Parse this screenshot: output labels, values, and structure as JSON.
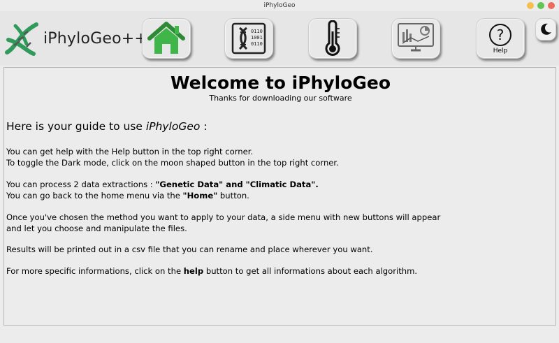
{
  "window": {
    "title": "iPhyloGeo"
  },
  "logo": {
    "text": "iPhyloGeo++"
  },
  "toolbar": {
    "home_icon": "house-icon",
    "genetic_icon": "dna-data-icon",
    "climate_icon": "thermometer-icon",
    "stats_icon": "chart-monitor-icon",
    "help_label": "Help",
    "help_icon": "question-circle-icon",
    "dark_mode_icon": "moon-icon"
  },
  "main": {
    "title": "Welcome to iPhyloGeo",
    "subtitle": "Thanks for downloading our software",
    "guide_prefix": "Here is your guide to use ",
    "guide_app": "iPhyloGeo",
    "guide_suffix": " :",
    "p1_line1": "You can get help with the Help button in the top right corner.",
    "p1_line2": "To toggle the Dark mode, click on the moon shaped button in the top right corner.",
    "p2_line1_a": "You can process 2 data extractions : ",
    "p2_line1_b": "\"Genetic Data\" and \"Climatic Data\".",
    "p2_line2_a": "You can go back to the home menu via the ",
    "p2_line2_b": "\"Home\"",
    "p2_line2_c": " button.",
    "p3_line1": "Once you've chosen the method you want to apply to your data, a side menu with new buttons will appear",
    "p3_line2": "and let you choose and manipulate the files.",
    "p4": "Results will be printed out in a csv file that you can rename and place wherever you want.",
    "p5_a": "For more specific informations, click on the ",
    "p5_b": "help",
    "p5_c": " button to get all informations about each algorithm."
  },
  "colors": {
    "home_green": "#3fb54a",
    "dna_green": "#2f9a5a",
    "window_yellow": "#f4bf4f",
    "window_green": "#61c454",
    "window_red": "#ed6a5e"
  }
}
